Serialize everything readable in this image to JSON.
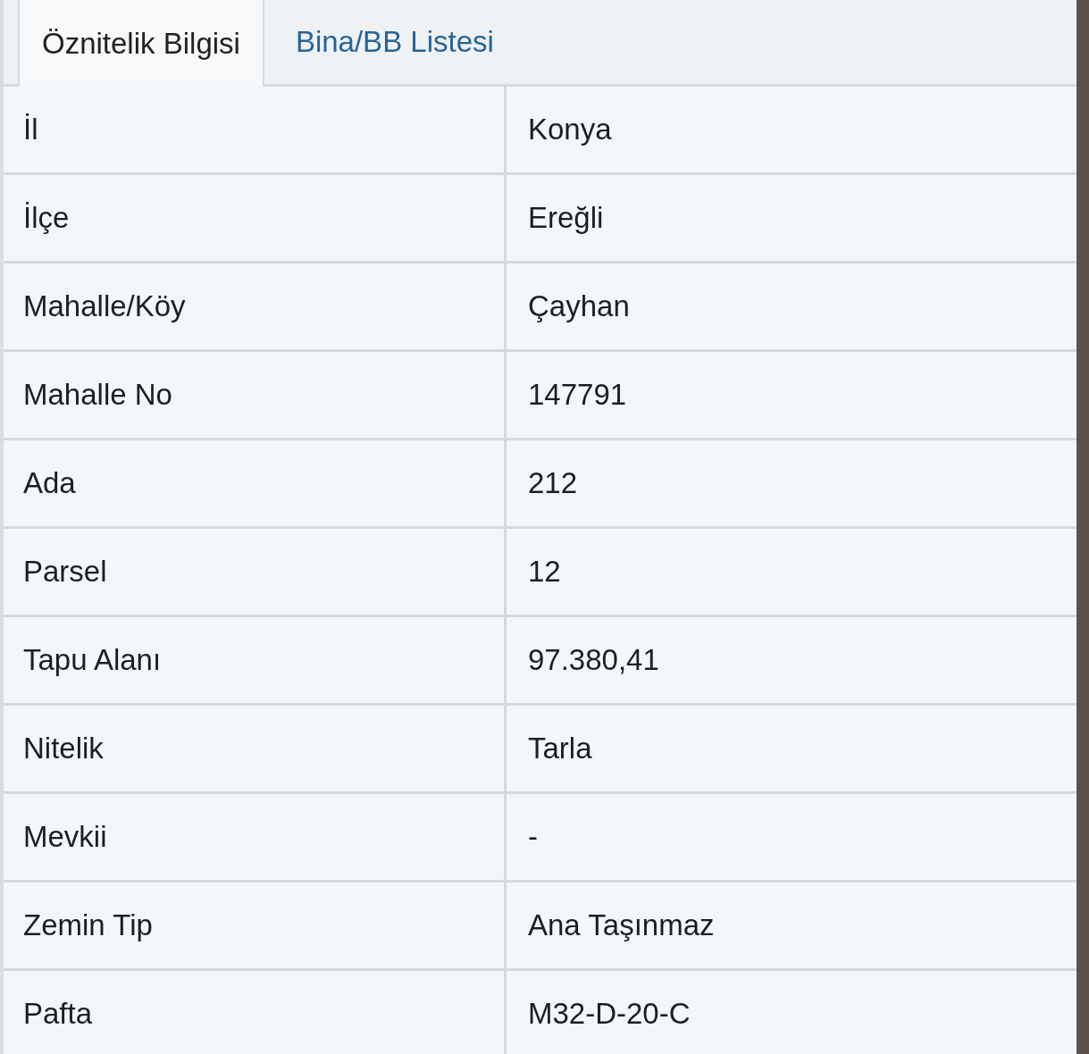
{
  "tabs": [
    {
      "label": "Öznitelik Bilgisi",
      "selected": true
    },
    {
      "label": "Bina/BB Listesi",
      "selected": false
    }
  ],
  "rows": [
    {
      "label": "İl",
      "value": "Konya"
    },
    {
      "label": "İlçe",
      "value": "Ereğli"
    },
    {
      "label": "Mahalle/Köy",
      "value": "Çayhan"
    },
    {
      "label": "Mahalle No",
      "value": "147791"
    },
    {
      "label": "Ada",
      "value": "212"
    },
    {
      "label": "Parsel",
      "value": "12"
    },
    {
      "label": "Tapu Alanı",
      "value": "97.380,41"
    },
    {
      "label": "Nitelik",
      "value": "Tarla"
    },
    {
      "label": "Mevkii",
      "value": "-"
    },
    {
      "label": "Zemin Tip",
      "value": "Ana Taşınmaz"
    },
    {
      "label": "Pafta",
      "value": "M32-D-20-C"
    }
  ]
}
